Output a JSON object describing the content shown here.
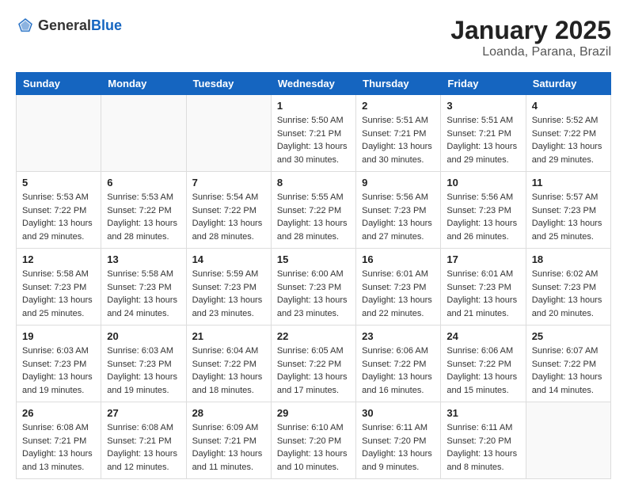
{
  "header": {
    "logo_general": "General",
    "logo_blue": "Blue",
    "title": "January 2025",
    "subtitle": "Loanda, Parana, Brazil"
  },
  "weekdays": [
    "Sunday",
    "Monday",
    "Tuesday",
    "Wednesday",
    "Thursday",
    "Friday",
    "Saturday"
  ],
  "weeks": [
    [
      {
        "day": "",
        "info": ""
      },
      {
        "day": "",
        "info": ""
      },
      {
        "day": "",
        "info": ""
      },
      {
        "day": "1",
        "info": "Sunrise: 5:50 AM\nSunset: 7:21 PM\nDaylight: 13 hours\nand 30 minutes."
      },
      {
        "day": "2",
        "info": "Sunrise: 5:51 AM\nSunset: 7:21 PM\nDaylight: 13 hours\nand 30 minutes."
      },
      {
        "day": "3",
        "info": "Sunrise: 5:51 AM\nSunset: 7:21 PM\nDaylight: 13 hours\nand 29 minutes."
      },
      {
        "day": "4",
        "info": "Sunrise: 5:52 AM\nSunset: 7:22 PM\nDaylight: 13 hours\nand 29 minutes."
      }
    ],
    [
      {
        "day": "5",
        "info": "Sunrise: 5:53 AM\nSunset: 7:22 PM\nDaylight: 13 hours\nand 29 minutes."
      },
      {
        "day": "6",
        "info": "Sunrise: 5:53 AM\nSunset: 7:22 PM\nDaylight: 13 hours\nand 28 minutes."
      },
      {
        "day": "7",
        "info": "Sunrise: 5:54 AM\nSunset: 7:22 PM\nDaylight: 13 hours\nand 28 minutes."
      },
      {
        "day": "8",
        "info": "Sunrise: 5:55 AM\nSunset: 7:22 PM\nDaylight: 13 hours\nand 28 minutes."
      },
      {
        "day": "9",
        "info": "Sunrise: 5:56 AM\nSunset: 7:23 PM\nDaylight: 13 hours\nand 27 minutes."
      },
      {
        "day": "10",
        "info": "Sunrise: 5:56 AM\nSunset: 7:23 PM\nDaylight: 13 hours\nand 26 minutes."
      },
      {
        "day": "11",
        "info": "Sunrise: 5:57 AM\nSunset: 7:23 PM\nDaylight: 13 hours\nand 25 minutes."
      }
    ],
    [
      {
        "day": "12",
        "info": "Sunrise: 5:58 AM\nSunset: 7:23 PM\nDaylight: 13 hours\nand 25 minutes."
      },
      {
        "day": "13",
        "info": "Sunrise: 5:58 AM\nSunset: 7:23 PM\nDaylight: 13 hours\nand 24 minutes."
      },
      {
        "day": "14",
        "info": "Sunrise: 5:59 AM\nSunset: 7:23 PM\nDaylight: 13 hours\nand 23 minutes."
      },
      {
        "day": "15",
        "info": "Sunrise: 6:00 AM\nSunset: 7:23 PM\nDaylight: 13 hours\nand 23 minutes."
      },
      {
        "day": "16",
        "info": "Sunrise: 6:01 AM\nSunset: 7:23 PM\nDaylight: 13 hours\nand 22 minutes."
      },
      {
        "day": "17",
        "info": "Sunrise: 6:01 AM\nSunset: 7:23 PM\nDaylight: 13 hours\nand 21 minutes."
      },
      {
        "day": "18",
        "info": "Sunrise: 6:02 AM\nSunset: 7:23 PM\nDaylight: 13 hours\nand 20 minutes."
      }
    ],
    [
      {
        "day": "19",
        "info": "Sunrise: 6:03 AM\nSunset: 7:23 PM\nDaylight: 13 hours\nand 19 minutes."
      },
      {
        "day": "20",
        "info": "Sunrise: 6:03 AM\nSunset: 7:23 PM\nDaylight: 13 hours\nand 19 minutes."
      },
      {
        "day": "21",
        "info": "Sunrise: 6:04 AM\nSunset: 7:22 PM\nDaylight: 13 hours\nand 18 minutes."
      },
      {
        "day": "22",
        "info": "Sunrise: 6:05 AM\nSunset: 7:22 PM\nDaylight: 13 hours\nand 17 minutes."
      },
      {
        "day": "23",
        "info": "Sunrise: 6:06 AM\nSunset: 7:22 PM\nDaylight: 13 hours\nand 16 minutes."
      },
      {
        "day": "24",
        "info": "Sunrise: 6:06 AM\nSunset: 7:22 PM\nDaylight: 13 hours\nand 15 minutes."
      },
      {
        "day": "25",
        "info": "Sunrise: 6:07 AM\nSunset: 7:22 PM\nDaylight: 13 hours\nand 14 minutes."
      }
    ],
    [
      {
        "day": "26",
        "info": "Sunrise: 6:08 AM\nSunset: 7:21 PM\nDaylight: 13 hours\nand 13 minutes."
      },
      {
        "day": "27",
        "info": "Sunrise: 6:08 AM\nSunset: 7:21 PM\nDaylight: 13 hours\nand 12 minutes."
      },
      {
        "day": "28",
        "info": "Sunrise: 6:09 AM\nSunset: 7:21 PM\nDaylight: 13 hours\nand 11 minutes."
      },
      {
        "day": "29",
        "info": "Sunrise: 6:10 AM\nSunset: 7:20 PM\nDaylight: 13 hours\nand 10 minutes."
      },
      {
        "day": "30",
        "info": "Sunrise: 6:11 AM\nSunset: 7:20 PM\nDaylight: 13 hours\nand 9 minutes."
      },
      {
        "day": "31",
        "info": "Sunrise: 6:11 AM\nSunset: 7:20 PM\nDaylight: 13 hours\nand 8 minutes."
      },
      {
        "day": "",
        "info": ""
      }
    ]
  ]
}
